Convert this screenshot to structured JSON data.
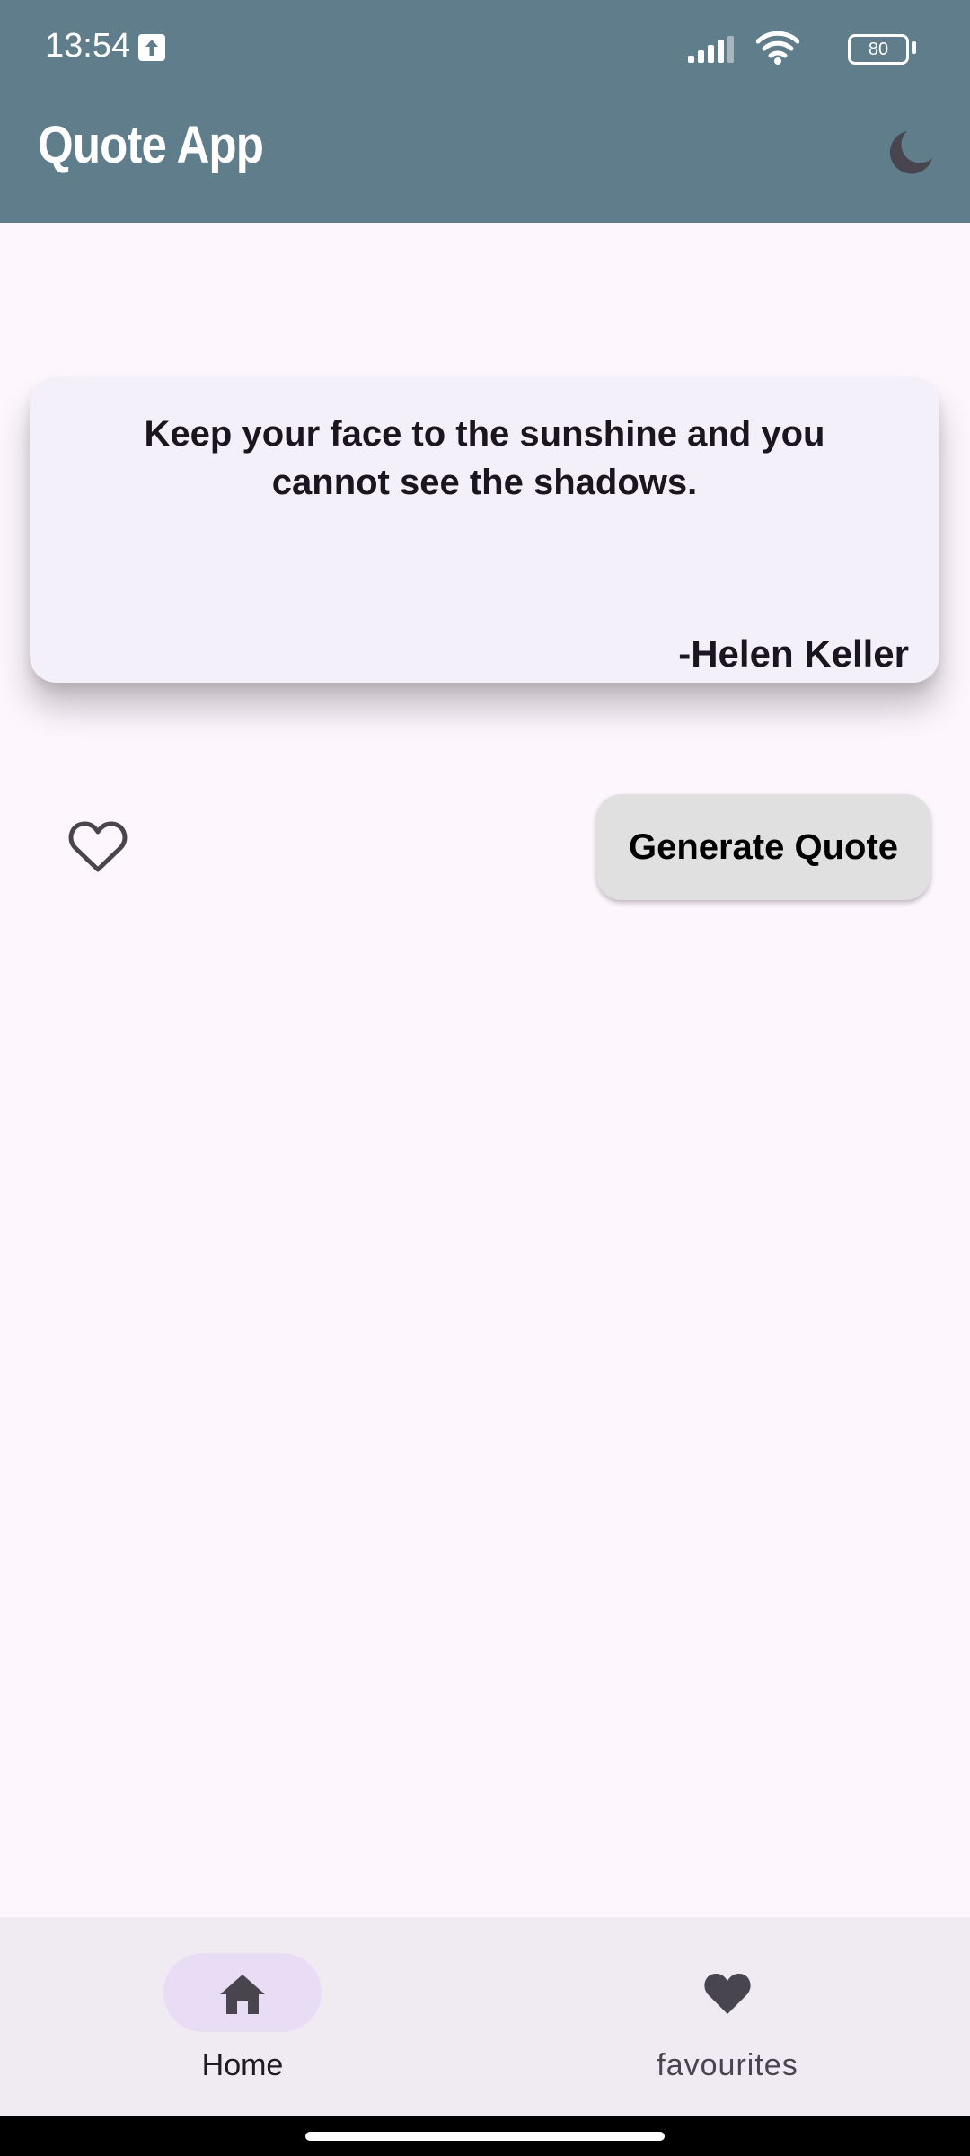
{
  "status_bar": {
    "time": "13:54",
    "battery": "80"
  },
  "app_bar": {
    "title": "Quote App",
    "theme_icon": "moon-icon"
  },
  "quote": {
    "text": "Keep your face to the sunshine and you cannot see the shadows.",
    "author": "-Helen Keller"
  },
  "actions": {
    "favorite_icon": "heart-outline-icon",
    "generate_label": "Generate Quote"
  },
  "bottom_nav": {
    "items": [
      {
        "label": "Home",
        "icon": "home-icon",
        "selected": true
      },
      {
        "label": "favourites",
        "icon": "heart-icon",
        "selected": false
      }
    ]
  },
  "colors": {
    "app_bar": "#607d8b",
    "background": "#fdf6fd",
    "card": "#f4f0f9",
    "button": "#e0e0e0",
    "nav_bar": "#f0ebf3",
    "nav_indicator": "#e8ddf4",
    "icon": "#49454f"
  }
}
